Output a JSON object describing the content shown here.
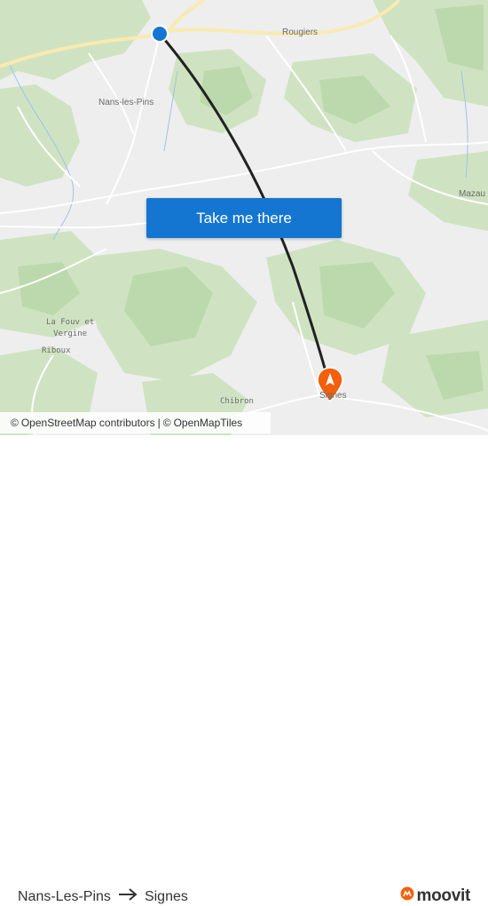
{
  "map": {
    "places": {
      "rougiers": "Rougiers",
      "nans_les_pins": "Nans-les-Pins",
      "mazaugues": "Mazau",
      "la_fouv_line1": "La Fouv et",
      "la_fouv_line2": "Vergine",
      "riboux": "Riboux",
      "chibron": "Chibron",
      "signes": "Signes"
    },
    "origin_marker_color": "#1476d1",
    "destination_marker_color": "#f2600c",
    "route_line_color": "#222222",
    "icons": {
      "origin": "origin-dot-icon",
      "destination": "destination-pin-icon"
    }
  },
  "cta": {
    "label": "Take me there",
    "color": "#1476d1"
  },
  "attribution": {
    "copyright_symbol": "©",
    "osm": "OpenStreetMap contributors",
    "separator": "|",
    "copyright_symbol_2": "©",
    "tiles": "OpenMapTiles"
  },
  "footer": {
    "from": "Nans-Les-Pins",
    "to": "Signes",
    "arrow_icon": "right-arrow-icon",
    "brand": "moovit",
    "brand_color": "#f2600c"
  }
}
